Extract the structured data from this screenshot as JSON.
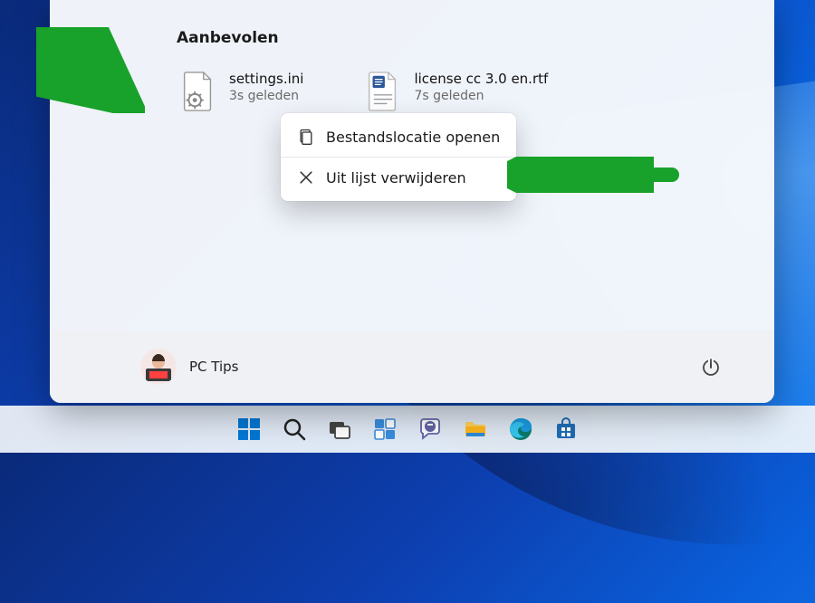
{
  "start_panel": {
    "section_title": "Aanbevolen",
    "items": [
      {
        "name": "settings.ini",
        "time": "3s geleden",
        "icon": "ini-file"
      },
      {
        "name": "license cc 3.0 en.rtf",
        "time": "7s geleden",
        "icon": "rtf-file"
      }
    ]
  },
  "context_menu": {
    "open_location": "Bestandslocatie openen",
    "remove": "Uit lijst verwijderen"
  },
  "user": {
    "name": "PC Tips"
  },
  "taskbar": {
    "items": [
      "start",
      "search",
      "task-view",
      "widgets",
      "chat",
      "file-explorer",
      "edge",
      "microsoft-store"
    ]
  },
  "colors": {
    "arrow": "#18a22b"
  }
}
